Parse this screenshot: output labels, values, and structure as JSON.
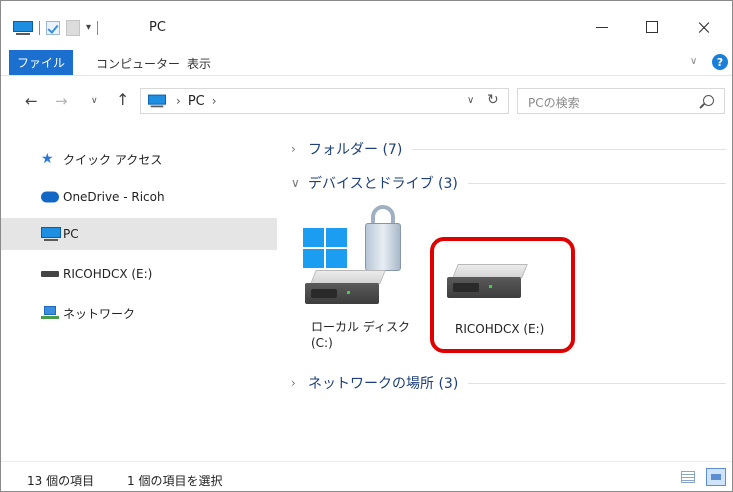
{
  "window": {
    "title": "PC",
    "controls": {
      "minimize": "minimize",
      "maximize": "maximize",
      "close": "×"
    }
  },
  "ribbon": {
    "tabs": [
      {
        "label": "ファイル",
        "active": true
      },
      {
        "label": "コンピューター",
        "active": false
      },
      {
        "label": "表示",
        "active": false
      }
    ],
    "help": "?"
  },
  "address_bar": {
    "back": "←",
    "forward": "→",
    "recent": "∨",
    "up": "↑",
    "path": [
      "PC"
    ],
    "separator": "›",
    "dropdown": "∨",
    "refresh": "↻",
    "search_placeholder": "PCの検索"
  },
  "sidebar": {
    "items": [
      {
        "label": "クイック アクセス",
        "icon": "star-icon",
        "selected": false
      },
      {
        "label": "OneDrive - Ricoh",
        "icon": "cloud-icon",
        "selected": false
      },
      {
        "label": "PC",
        "icon": "pc-icon",
        "selected": true
      },
      {
        "label": "RICOHDCX (E:)",
        "icon": "drive-icon",
        "selected": false
      },
      {
        "label": "ネットワーク",
        "icon": "network-icon",
        "selected": false
      }
    ]
  },
  "content": {
    "groups": [
      {
        "chevron": "›",
        "title": "フォルダー (7)",
        "expanded": false
      },
      {
        "chevron": "∨",
        "title": "デバイスとドライブ (3)",
        "expanded": true
      },
      {
        "chevron": "›",
        "title": "ネットワークの場所 (3)",
        "expanded": false
      }
    ],
    "drives": [
      {
        "label_line1": "ローカル ディスク",
        "label_line2": "(C:)",
        "icon": "system-drive-icon"
      },
      {
        "label_line1": "RICOHDCX (E:)",
        "label_line2": "",
        "icon": "hard-drive-icon",
        "highlighted": true
      }
    ],
    "highlight_color": "#e00000"
  },
  "status_bar": {
    "item_count": "13 個の項目",
    "selection": "1 個の項目を選択"
  },
  "colors": {
    "accent": "#1a6fcf",
    "group_title": "#1e3f7a",
    "selected_bg": "#e5e5e5"
  }
}
